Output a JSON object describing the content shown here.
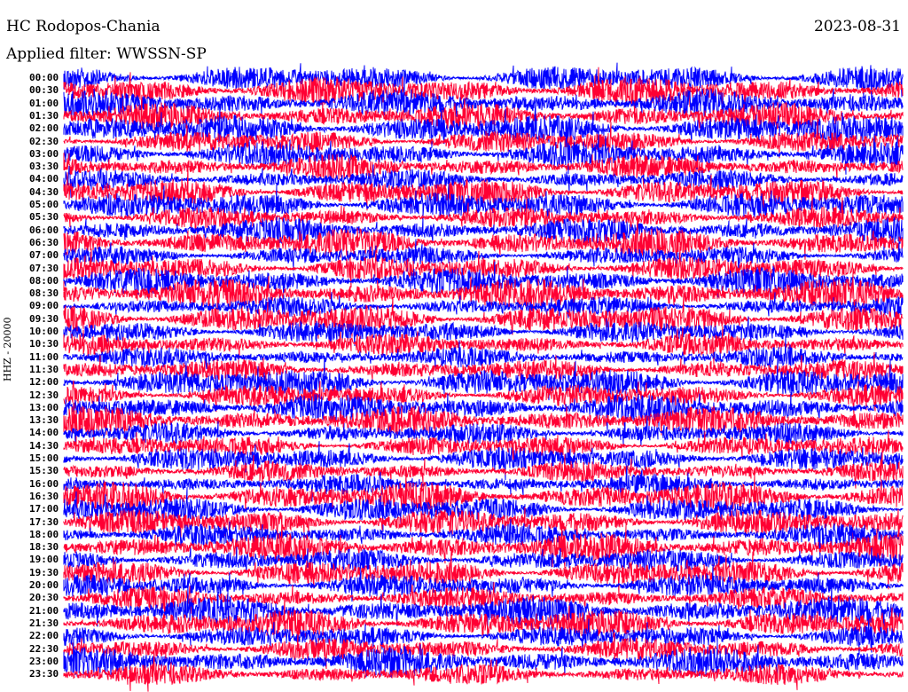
{
  "header": {
    "station": "HC Rodopos-Chania",
    "date": "2023-08-31",
    "filter": "Applied filter: WWSSN-SP"
  },
  "chart_data": {
    "type": "line",
    "title": "HC Rodopos-Chania",
    "subtitle": "Applied filter: WWSSN-SP",
    "ylabel": "HHZ - 20000",
    "xlabel": "",
    "row_labels": [
      "00:00",
      "00:30",
      "01:00",
      "01:30",
      "02:00",
      "02:30",
      "03:00",
      "03:30",
      "04:00",
      "04:30",
      "05:00",
      "05:30",
      "06:00",
      "06:30",
      "07:00",
      "07:30",
      "08:00",
      "08:30",
      "09:00",
      "09:30",
      "10:00",
      "10:30",
      "11:00",
      "11:30",
      "12:00",
      "12:30",
      "13:00",
      "13:30",
      "14:00",
      "14:30",
      "15:00",
      "15:30",
      "16:00",
      "16:30",
      "17:00",
      "17:30",
      "18:00",
      "18:30",
      "19:00",
      "19:30",
      "20:00",
      "20:30",
      "21:00",
      "21:30",
      "22:00",
      "22:30",
      "23:00",
      "23:30"
    ],
    "colors": [
      "#0000ff",
      "#ff0033"
    ],
    "grid": false
  }
}
